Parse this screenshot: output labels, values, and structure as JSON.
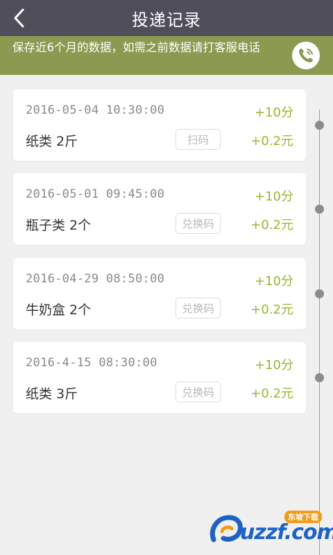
{
  "header": {
    "title": "投递记录"
  },
  "notice": {
    "text": "保存近6个月的数据，如需之前数据请打客服电话"
  },
  "records": [
    {
      "time": "2016-05-04 10:30:00",
      "points": "+10分",
      "item": "纸类 2斤",
      "code_label": "扫码",
      "money": "+0.2元"
    },
    {
      "time": "2016-05-01 09:45:00",
      "points": "+10分",
      "item": "瓶子类 2个",
      "code_label": "兑换码",
      "money": "+0.2元"
    },
    {
      "time": "2016-04-29 08:50:00",
      "points": "+10分",
      "item": "牛奶盒 2个",
      "code_label": "兑换码",
      "money": "+0.2元"
    },
    {
      "time": "2016-4-15 08:30:00",
      "points": "+10分",
      "item": "纸类 3斤",
      "code_label": "兑换码",
      "money": "+0.2元"
    }
  ],
  "watermark": {
    "text": "uzzf.com",
    "badge": "东坡下载"
  },
  "colors": {
    "header_bg": "#4f4e5a",
    "notice_bg": "#8a9a50",
    "accent_green": "#95b82b"
  },
  "icons": {
    "back": "chevron-left-icon",
    "phone": "phone-icon"
  }
}
